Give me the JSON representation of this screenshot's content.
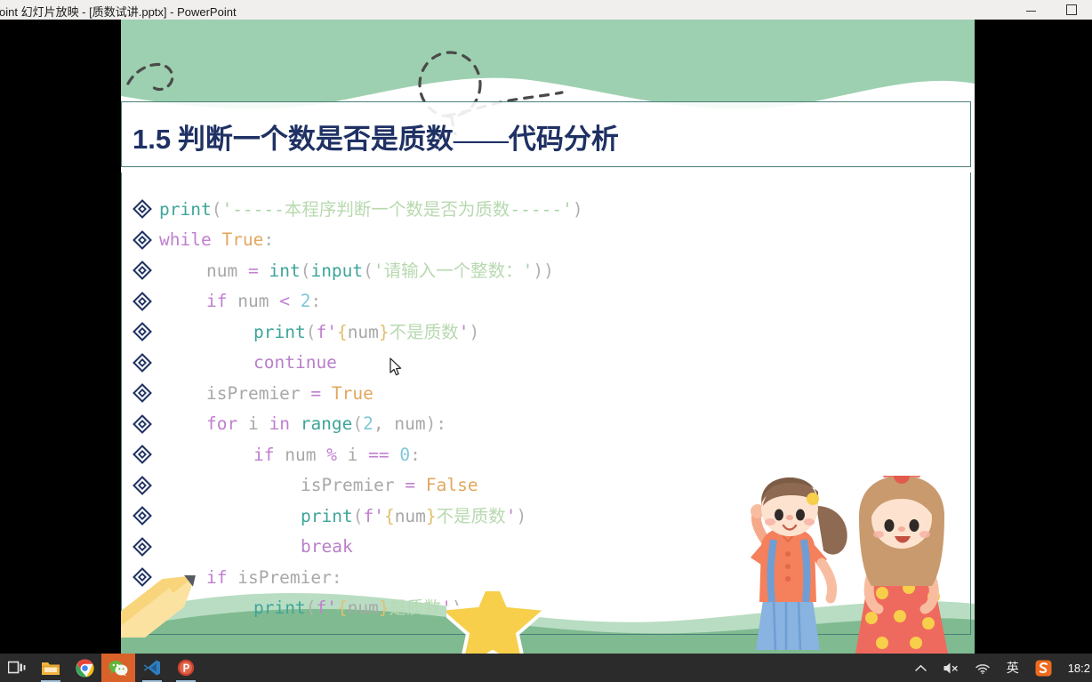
{
  "window": {
    "title": "rPoint 幻灯片放映 - [质数试讲.pptx] - PowerPoint",
    "minimize_label": "最小化",
    "maximize_label": "最大化"
  },
  "slide": {
    "title_number": "1.5",
    "title_text": " 判断一个数是否是质数——代码分析",
    "accent_border_color": "#4b7f7a",
    "title_color": "#1f3164",
    "wave_color": "#9dd0b0",
    "hill_color_back": "#b9ddc2",
    "hill_color_front": "#7fba90",
    "bullet_color": "#1f3164",
    "code_lines": [
      {
        "indent": 0,
        "tokens": [
          {
            "t": "print",
            "c": "c-func"
          },
          {
            "t": "(",
            "c": "c-punct"
          },
          {
            "t": "'-----",
            "c": "c-str"
          },
          {
            "t": "本程序判断一个数是否为质数",
            "c": "c-cjk"
          },
          {
            "t": "-----'",
            "c": "c-str"
          },
          {
            "t": ")",
            "c": "c-punct"
          }
        ]
      },
      {
        "indent": 0,
        "tokens": [
          {
            "t": "while",
            "c": "c-kw"
          },
          {
            "t": " ",
            "c": "c-plain"
          },
          {
            "t": "True",
            "c": "c-const"
          },
          {
            "t": ":",
            "c": "c-punct"
          }
        ]
      },
      {
        "indent": 1,
        "tokens": [
          {
            "t": "num ",
            "c": "c-plain"
          },
          {
            "t": "=",
            "c": "c-op"
          },
          {
            "t": " ",
            "c": "c-plain"
          },
          {
            "t": "int",
            "c": "c-func"
          },
          {
            "t": "(",
            "c": "c-punct"
          },
          {
            "t": "input",
            "c": "c-func"
          },
          {
            "t": "(",
            "c": "c-punct"
          },
          {
            "t": "'",
            "c": "c-str"
          },
          {
            "t": "请输入一个整数：",
            "c": "c-cjk"
          },
          {
            "t": "'",
            "c": "c-str"
          },
          {
            "t": "))",
            "c": "c-punct"
          }
        ]
      },
      {
        "indent": 1,
        "tokens": [
          {
            "t": "if",
            "c": "c-kw"
          },
          {
            "t": " num ",
            "c": "c-plain"
          },
          {
            "t": "<",
            "c": "c-op"
          },
          {
            "t": " ",
            "c": "c-plain"
          },
          {
            "t": "2",
            "c": "c-num"
          },
          {
            "t": ":",
            "c": "c-punct"
          }
        ]
      },
      {
        "indent": 2,
        "tokens": [
          {
            "t": "print",
            "c": "c-func"
          },
          {
            "t": "(",
            "c": "c-punct"
          },
          {
            "t": "f'",
            "c": "c-fstr"
          },
          {
            "t": "{",
            "c": "c-brace"
          },
          {
            "t": "num",
            "c": "c-plain"
          },
          {
            "t": "}",
            "c": "c-brace"
          },
          {
            "t": "不是质数",
            "c": "c-cjk"
          },
          {
            "t": "'",
            "c": "c-fstr"
          },
          {
            "t": ")",
            "c": "c-punct"
          }
        ]
      },
      {
        "indent": 2,
        "tokens": [
          {
            "t": "continue",
            "c": "c-kw2"
          }
        ]
      },
      {
        "indent": 1,
        "tokens": [
          {
            "t": "isPremier ",
            "c": "c-plain"
          },
          {
            "t": "=",
            "c": "c-op"
          },
          {
            "t": " ",
            "c": "c-plain"
          },
          {
            "t": "True",
            "c": "c-const"
          }
        ]
      },
      {
        "indent": 1,
        "tokens": [
          {
            "t": "for",
            "c": "c-kw"
          },
          {
            "t": " i ",
            "c": "c-plain"
          },
          {
            "t": "in",
            "c": "c-kw"
          },
          {
            "t": " ",
            "c": "c-plain"
          },
          {
            "t": "range",
            "c": "c-func"
          },
          {
            "t": "(",
            "c": "c-punct"
          },
          {
            "t": "2",
            "c": "c-num"
          },
          {
            "t": ", num",
            "c": "c-plain"
          },
          {
            "t": "):",
            "c": "c-punct"
          }
        ]
      },
      {
        "indent": 2,
        "tokens": [
          {
            "t": "if",
            "c": "c-kw"
          },
          {
            "t": " num ",
            "c": "c-plain"
          },
          {
            "t": "%",
            "c": "c-op"
          },
          {
            "t": " i ",
            "c": "c-plain"
          },
          {
            "t": "==",
            "c": "c-op"
          },
          {
            "t": " ",
            "c": "c-plain"
          },
          {
            "t": "0",
            "c": "c-num"
          },
          {
            "t": ":",
            "c": "c-punct"
          }
        ]
      },
      {
        "indent": 3,
        "tokens": [
          {
            "t": "isPremier ",
            "c": "c-plain"
          },
          {
            "t": "=",
            "c": "c-op"
          },
          {
            "t": " ",
            "c": "c-plain"
          },
          {
            "t": "False",
            "c": "c-const"
          }
        ]
      },
      {
        "indent": 3,
        "tokens": [
          {
            "t": "print",
            "c": "c-func"
          },
          {
            "t": "(",
            "c": "c-punct"
          },
          {
            "t": "f'",
            "c": "c-fstr"
          },
          {
            "t": "{",
            "c": "c-brace"
          },
          {
            "t": "num",
            "c": "c-plain"
          },
          {
            "t": "}",
            "c": "c-brace"
          },
          {
            "t": "不是质数",
            "c": "c-cjk"
          },
          {
            "t": "'",
            "c": "c-fstr"
          },
          {
            "t": ")",
            "c": "c-punct"
          }
        ]
      },
      {
        "indent": 3,
        "tokens": [
          {
            "t": "break",
            "c": "c-kw2"
          }
        ]
      },
      {
        "indent": 1,
        "tokens": [
          {
            "t": "if",
            "c": "c-kw"
          },
          {
            "t": " isPremier",
            "c": "c-plain"
          },
          {
            "t": ":",
            "c": "c-punct"
          }
        ]
      },
      {
        "indent": 2,
        "tokens": [
          {
            "t": "print",
            "c": "c-func"
          },
          {
            "t": "(",
            "c": "c-punct"
          },
          {
            "t": "f'",
            "c": "c-fstr"
          },
          {
            "t": "{",
            "c": "c-brace"
          },
          {
            "t": "num",
            "c": "c-plain"
          },
          {
            "t": "}",
            "c": "c-brace"
          },
          {
            "t": "是质数",
            "c": "c-cjk"
          },
          {
            "t": "'",
            "c": "c-fstr"
          },
          {
            "t": ")",
            "c": "c-punct"
          }
        ]
      }
    ]
  },
  "taskbar": {
    "background": "#2b2b2b",
    "items": [
      {
        "name": "task-view",
        "label": "任务视图"
      },
      {
        "name": "file-explorer",
        "label": "文件资源管理器"
      },
      {
        "name": "chrome",
        "label": "Google Chrome"
      },
      {
        "name": "wechat",
        "label": "微信"
      },
      {
        "name": "vscode",
        "label": "Visual Studio Code"
      },
      {
        "name": "powerpoint",
        "label": "PowerPoint"
      }
    ],
    "tray": {
      "chevron": "∧",
      "volume_state": "muted",
      "network": "wifi",
      "ime_label": "英",
      "ime_app": "S",
      "clock": "18:2"
    }
  }
}
